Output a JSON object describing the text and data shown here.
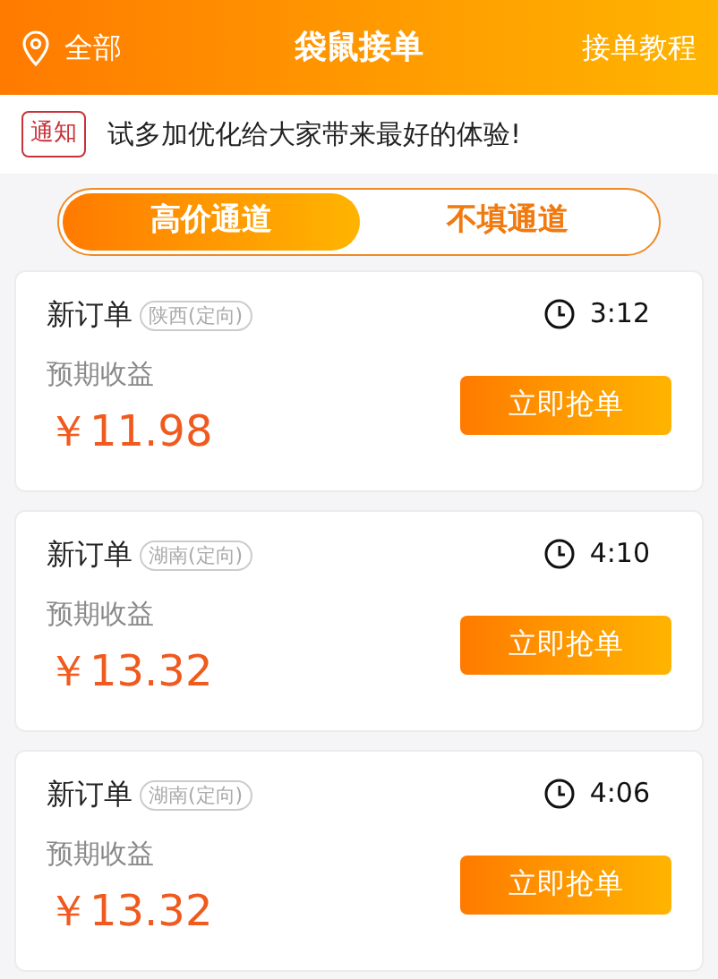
{
  "header": {
    "location": "全部",
    "title": "袋鼠接单",
    "link": "接单教程"
  },
  "notice": {
    "badge": "通知",
    "text": "试多加优化给大家带来最好的体验!"
  },
  "tabs": [
    {
      "label": "高价通道",
      "selected": true
    },
    {
      "label": "不填通道",
      "selected": false
    }
  ],
  "orders": [
    {
      "title": "新订单",
      "tag": "陕西(定向)",
      "time": "3:12",
      "income_label": "预期收益",
      "amount": "￥11.98",
      "button": "立即抢单"
    },
    {
      "title": "新订单",
      "tag": "湖南(定向)",
      "time": "4:10",
      "income_label": "预期收益",
      "amount": "￥13.32",
      "button": "立即抢单"
    },
    {
      "title": "新订单",
      "tag": "湖南(定向)",
      "time": "4:06",
      "income_label": "预期收益",
      "amount": "￥13.32",
      "button": "立即抢单"
    }
  ]
}
